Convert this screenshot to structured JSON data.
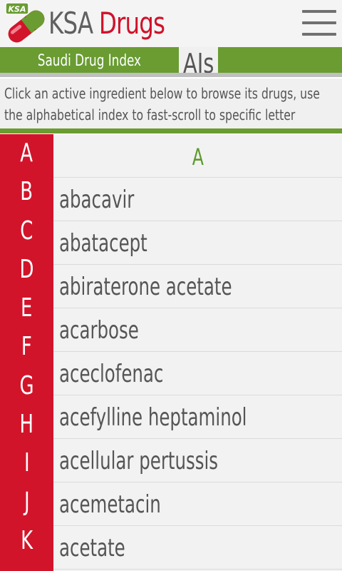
{
  "app": {
    "logo_badge": "KSA",
    "brand_ksa": "KSA",
    "brand_drugs": "Drugs"
  },
  "title_bar": {
    "label": "Saudi Drug Index",
    "tab": "AIs"
  },
  "description": "Click an active ingredient below to browse its drugs, use the alphabetical index to fast-scroll to specific letter",
  "alphabet": [
    "A",
    "B",
    "C",
    "D",
    "E",
    "F",
    "G",
    "H",
    "I",
    "J",
    "K"
  ],
  "section_header": "A",
  "ingredients": [
    "abacavir",
    "abatacept",
    "abiraterone acetate",
    "acarbose",
    "aceclofenac",
    "acefylline heptaminol",
    "acellular pertussis",
    "acemetacin",
    "acetate"
  ],
  "colors": {
    "brand_red": "#d2142b",
    "brand_green": "#6a9c32",
    "text_grey": "#555555"
  },
  "icons": [
    "pill-logo-icon",
    "hamburger-menu-icon"
  ]
}
